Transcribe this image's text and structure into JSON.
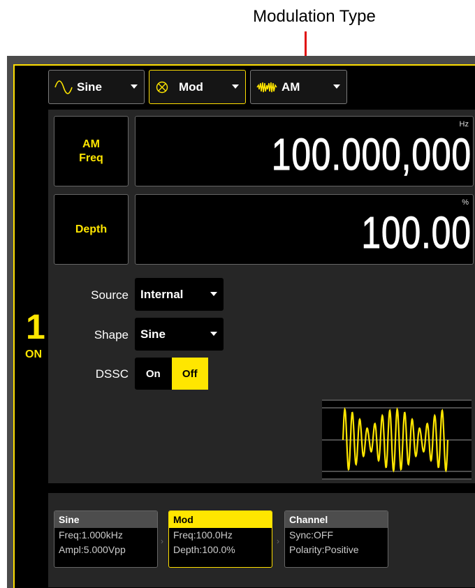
{
  "annotation": {
    "label": "Modulation Type",
    "arrow_color": "#e01010"
  },
  "channel": {
    "number": "1",
    "state": "ON"
  },
  "toolbar": {
    "waveform": {
      "label": "Sine",
      "icon": "sine-wave-icon"
    },
    "mode": {
      "label": "Mod",
      "icon": "modulation-icon"
    },
    "mod_type": {
      "label": "AM",
      "icon": "am-wave-icon"
    }
  },
  "params": {
    "am_freq": {
      "label_line1": "AM",
      "label_line2": "Freq",
      "unit": "Hz",
      "value": "100.000,000"
    },
    "depth": {
      "label": "Depth",
      "unit": "%",
      "value": "100.00"
    }
  },
  "settings": {
    "source": {
      "label": "Source",
      "value": "Internal"
    },
    "shape": {
      "label": "Shape",
      "value": "Sine"
    },
    "dssc": {
      "label": "DSSC",
      "on_label": "On",
      "off_label": "Off",
      "selected": "Off"
    }
  },
  "summary": [
    {
      "title": "Sine",
      "line1": "Freq:1.000kHz",
      "line2": "Ampl:5.000Vpp"
    },
    {
      "title": "Mod",
      "line1": "Freq:100.0Hz",
      "line2": "Depth:100.0%"
    },
    {
      "title": "Channel",
      "line1": "Sync:OFF",
      "line2": "Polarity:Positive"
    }
  ],
  "colors": {
    "accent": "#ffe600",
    "panel_bg": "#262626",
    "frame": "#4a4a4a"
  }
}
